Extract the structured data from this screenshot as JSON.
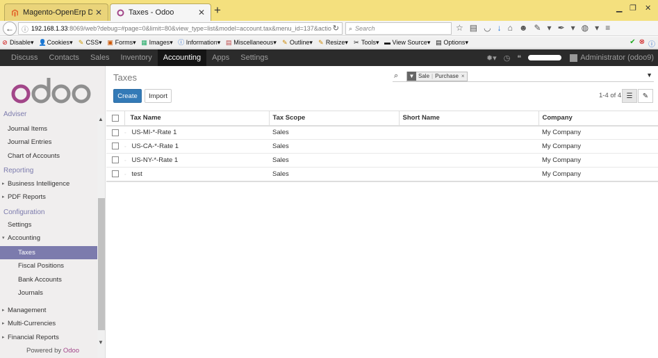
{
  "browser": {
    "tabs": [
      {
        "title": "Magento-OpenErp Deliver...",
        "active": false
      },
      {
        "title": "Taxes - Odoo",
        "active": true
      }
    ],
    "url_host": "192.168.1.33",
    "url_path": ":8069/web?debug=#page=0&limit=80&view_type=list&model=account.tax&menu_id=137&actio",
    "search_placeholder": "Search"
  },
  "devtoolbar": {
    "items": [
      "Disable",
      "Cookies",
      "CSS",
      "Forms",
      "Images",
      "Information",
      "Miscellaneous",
      "Outline",
      "Resize",
      "Tools",
      "View Source",
      "Options"
    ]
  },
  "odoo_menu": {
    "items": [
      "Discuss",
      "Contacts",
      "Sales",
      "Inventory",
      "Accounting",
      "Apps",
      "Settings"
    ],
    "active": "Accounting",
    "user": "Administrator (odoo9)"
  },
  "sidebar": {
    "cut_heading": "Adviser",
    "adviser_items": [
      "Journal Items",
      "Journal Entries",
      "Chart of Accounts"
    ],
    "reporting_heading": "Reporting",
    "reporting_items": [
      "Business Intelligence",
      "PDF Reports"
    ],
    "configuration_heading": "Configuration",
    "config_items": [
      "Settings",
      "Accounting"
    ],
    "accounting_children": [
      "Taxes",
      "Fiscal Positions",
      "Bank Accounts",
      "Journals"
    ],
    "bottom_items": [
      "Management",
      "Multi-Currencies",
      "Financial Reports"
    ],
    "powered_prefix": "Powered by",
    "powered_brand": "Odoo"
  },
  "main": {
    "title": "Taxes",
    "create_label": "Create",
    "import_label": "Import",
    "pager": "1-4 of 4",
    "facet": {
      "values": [
        "Sale",
        "Purchase"
      ]
    },
    "columns": [
      "Tax Name",
      "Tax Scope",
      "Short Name",
      "Company"
    ],
    "rows": [
      {
        "name": "US-MI-*-Rate 1",
        "scope": "Sales",
        "short": "",
        "company": "My Company"
      },
      {
        "name": "US-CA-*-Rate 1",
        "scope": "Sales",
        "short": "",
        "company": "My Company"
      },
      {
        "name": "US-NY-*-Rate 1",
        "scope": "Sales",
        "short": "",
        "company": "My Company"
      },
      {
        "name": "test",
        "scope": "Sales",
        "short": "",
        "company": "My Company"
      }
    ]
  },
  "colors": {
    "accent": "#7c7bad",
    "primary_btn": "#337ab7",
    "odoo_brand": "#a24689",
    "tabbar": "#f4e07e"
  }
}
